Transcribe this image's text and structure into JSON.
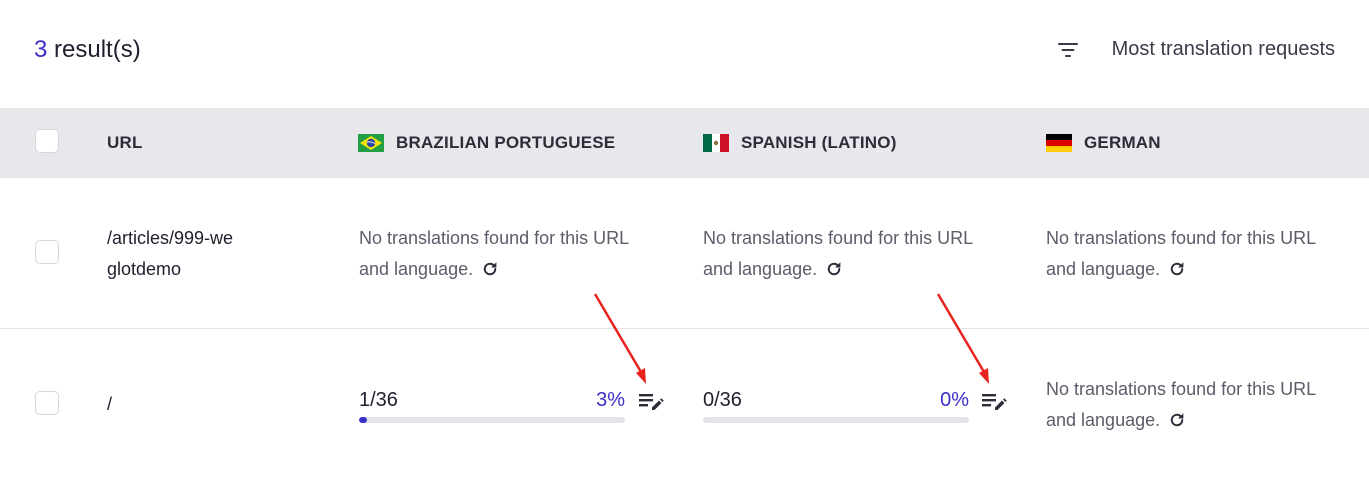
{
  "results": {
    "count": "3",
    "suffix": " result(s)"
  },
  "sort": {
    "label": "Most translation requests",
    "icon": "filter-sort-icon"
  },
  "table": {
    "columns": {
      "url": "URL",
      "lang1": {
        "label": "BRAZILIAN PORTUGUESE",
        "flag": "brazil-flag"
      },
      "lang2": {
        "label": "SPANISH (LATINO)",
        "flag": "mexico-flag"
      },
      "lang3": {
        "label": "GERMAN",
        "flag": "germany-flag"
      }
    },
    "rows": [
      {
        "url_line1": "/articles/999-we",
        "url_line2": "glotdemo",
        "lang1": {
          "line1": "No translations found for this URL",
          "line2": "and language."
        },
        "lang2": {
          "line1": "No translations found for this URL",
          "line2": "and language."
        },
        "lang3": {
          "line1": "No translations found for this URL",
          "line2": "and language."
        }
      },
      {
        "url_line1": "/",
        "lang1": {
          "count": "1/36",
          "percent": "3%",
          "progress": 0.03
        },
        "lang2": {
          "count": "0/36",
          "percent": "0%",
          "progress": 0.0
        },
        "lang3": {
          "line1": "No translations found for this URL",
          "line2": "and language."
        }
      }
    ]
  },
  "colors": {
    "accent": "#3b2fc9",
    "header_bg": "#e8e8ec",
    "annotation_arrow": "#e8231f"
  }
}
